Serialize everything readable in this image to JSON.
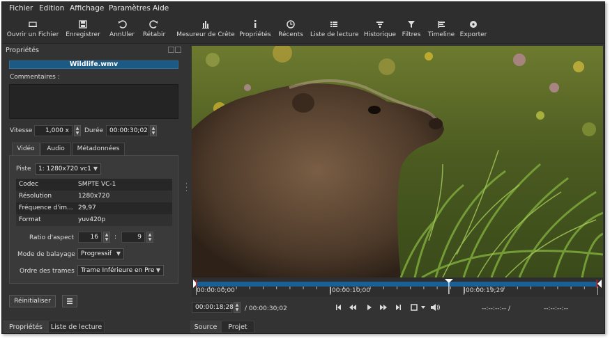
{
  "menu": [
    "Fichier",
    "Edition",
    "Affichage",
    "Paramètres",
    "Aide"
  ],
  "toolbar": [
    {
      "label": "Ouvrir un Fichier",
      "icon": "open-file-icon"
    },
    {
      "label": "Enregistrer",
      "icon": "save-icon"
    },
    {
      "label": "AnnUler",
      "icon": "undo-icon"
    },
    {
      "label": "Rétabir",
      "icon": "redo-icon"
    },
    {
      "label": "Mesureur de Crête",
      "icon": "peak-meter-icon"
    },
    {
      "label": "Propriétés",
      "icon": "info-icon"
    },
    {
      "label": "Récents",
      "icon": "clock-icon"
    },
    {
      "label": "Liste de lecture",
      "icon": "list-icon"
    },
    {
      "label": "Historique",
      "icon": "history-icon"
    },
    {
      "label": "Filtres",
      "icon": "filter-icon"
    },
    {
      "label": "Timeline",
      "icon": "timeline-icon"
    },
    {
      "label": "Exporter",
      "icon": "export-icon"
    }
  ],
  "properties": {
    "panel_title": "Propriétés",
    "filename": "Wildlife.wmv",
    "comments_label": "Commentaires :",
    "speed_label": "Vitesse",
    "speed_value": "1,000 x",
    "duration_label": "Durée",
    "duration_value": "00:00:30;02",
    "tabs": [
      "Vidéo",
      "Audio",
      "Métadonnées"
    ],
    "track_label": "Piste",
    "track_value": "1: 1280x720 vc1",
    "table": [
      {
        "key": "Codec",
        "value": "SMPTE VC-1"
      },
      {
        "key": "Résolution",
        "value": "1280x720"
      },
      {
        "key": "Fréquence d'im...",
        "value": "29,97"
      },
      {
        "key": "Format",
        "value": "yuv420p"
      }
    ],
    "aspect_label": "Ratio d'aspect",
    "aspect_w": "16",
    "aspect_sep": ":",
    "aspect_h": "9",
    "scan_label": "Mode de balayage",
    "scan_value": "Progressif",
    "order_label": "Ordre des trames",
    "order_value": "Trame Inférieure en Pren",
    "reset_label": "Réinitialiser",
    "menu_icon": "hamburger-icon"
  },
  "left_bottom_tabs": [
    "Propriétés",
    "Liste de lecture"
  ],
  "right_bottom_tabs": [
    "Source",
    "Projet"
  ],
  "player": {
    "ticks": [
      "00:00:00;00",
      "|00:00:10;00",
      "|00:00:19;29"
    ],
    "position": "00:00:18;28",
    "duration": "/ 00:00:30;02",
    "in_point": "--:--:--:-- /",
    "out_point": "--:--:--:--",
    "playhead_fraction": 0.63
  },
  "colors": {
    "accent": "#1c5a86",
    "timeline_track": "#1b6094",
    "playhead": "#ffffff",
    "in_out_marker": "#cc2222"
  }
}
